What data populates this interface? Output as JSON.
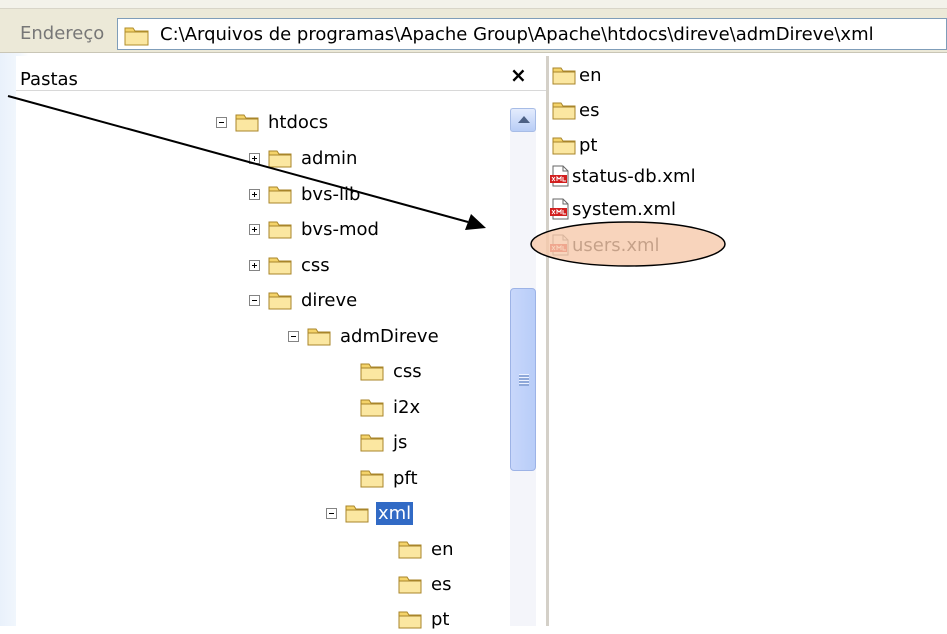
{
  "address_bar": {
    "label": "Endereço",
    "path": "C:\\Arquivos de programas\\Apache Group\\Apache\\htdocs\\direve\\admDireve\\xml"
  },
  "folders_pane": {
    "title": "Pastas",
    "close_symbol": "×",
    "tree": [
      {
        "label": "htdocs",
        "expander": "minus"
      },
      {
        "label": "admin",
        "expander": "plus"
      },
      {
        "label": "bvs-lib",
        "expander": "plus"
      },
      {
        "label": "bvs-mod",
        "expander": "plus"
      },
      {
        "label": "css",
        "expander": "plus"
      },
      {
        "label": "direve",
        "expander": "minus"
      },
      {
        "label": "admDireve",
        "expander": "minus"
      },
      {
        "label": "css",
        "expander": "none"
      },
      {
        "label": "i2x",
        "expander": "none"
      },
      {
        "label": "js",
        "expander": "none"
      },
      {
        "label": "pft",
        "expander": "none"
      },
      {
        "label": "xml",
        "expander": "minus",
        "selected": true
      },
      {
        "label": "en",
        "expander": "none"
      },
      {
        "label": "es",
        "expander": "none"
      },
      {
        "label": "pt",
        "expander": "none"
      }
    ]
  },
  "file_list": {
    "items": [
      {
        "label": "en",
        "type": "folder"
      },
      {
        "label": "es",
        "type": "folder"
      },
      {
        "label": "pt",
        "type": "folder"
      },
      {
        "label": "status-db.xml",
        "type": "xml"
      },
      {
        "label": "system.xml",
        "type": "xml"
      },
      {
        "label": "users.xml",
        "type": "xml",
        "highlighted": true
      }
    ]
  },
  "icons": {
    "folder": "folder-icon",
    "xml_file": "xml-file-icon",
    "expand": "plus-box-icon",
    "collapse": "minus-box-icon",
    "close": "close-icon"
  },
  "colors": {
    "selection": "#316ac5",
    "highlight_ellipse": "#f6c9ab",
    "folder": "#f4d36a"
  }
}
